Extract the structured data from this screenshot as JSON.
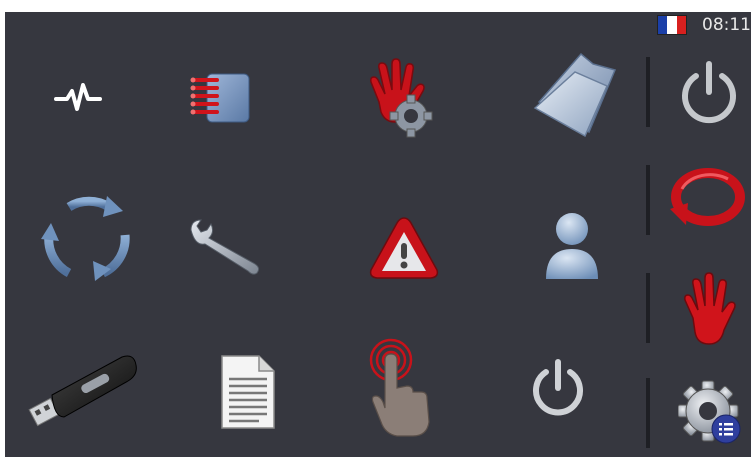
{
  "status_bar": {
    "language_flag": "flag-france-icon",
    "flag_colors": [
      "#1b3fa8",
      "#ffffff",
      "#d8201f"
    ],
    "time": "08:11"
  },
  "colors": {
    "background": "#36373f",
    "accent_red": "#c8121a",
    "icon_silver": "#9aa8bd",
    "icon_blue": "#6f8fb5"
  },
  "main_grid": [
    {
      "id": "signal",
      "icon": "pulse-signal-icon"
    },
    {
      "id": "list",
      "icon": "red-list-book-icon"
    },
    {
      "id": "manual-config",
      "icon": "hand-gear-icon"
    },
    {
      "id": "folder",
      "icon": "open-folder-icon"
    },
    {
      "id": "cycle",
      "icon": "refresh-cycle-icon"
    },
    {
      "id": "maintenance",
      "icon": "wrench-icon"
    },
    {
      "id": "alarms",
      "icon": "warning-triangle-icon"
    },
    {
      "id": "user",
      "icon": "user-person-icon"
    },
    {
      "id": "usb",
      "icon": "usb-drive-icon"
    },
    {
      "id": "document",
      "icon": "document-icon"
    },
    {
      "id": "touch",
      "icon": "touch-finger-icon"
    },
    {
      "id": "shutdown",
      "icon": "power-icon"
    }
  ],
  "side_bar": [
    {
      "id": "power",
      "icon": "power-icon"
    },
    {
      "id": "reset",
      "icon": "red-cycle-arrow-icon"
    },
    {
      "id": "stop",
      "icon": "red-hand-icon"
    },
    {
      "id": "settings",
      "icon": "gear-list-icon"
    }
  ]
}
